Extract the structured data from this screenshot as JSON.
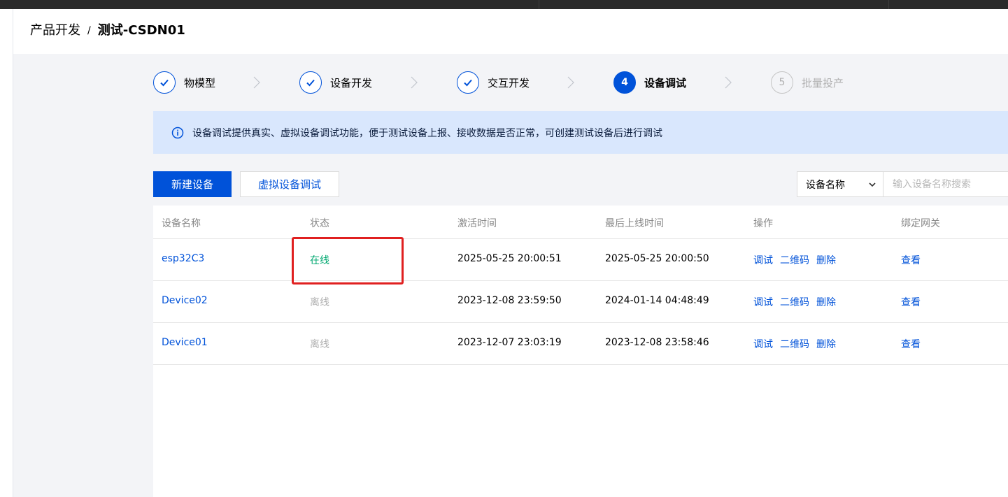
{
  "breadcrumb": {
    "parent": "产品开发",
    "separator": "/",
    "current": "测试-CSDN01"
  },
  "steps": [
    {
      "label": "物模型",
      "state": "done",
      "number": ""
    },
    {
      "label": "设备开发",
      "state": "done",
      "number": ""
    },
    {
      "label": "交互开发",
      "state": "done",
      "number": ""
    },
    {
      "label": "设备调试",
      "state": "active",
      "number": "4"
    },
    {
      "label": "批量投产",
      "state": "pending",
      "number": "5"
    }
  ],
  "notice": {
    "text": "设备调试提供真实、虚拟设备调试功能，便于测试设备上报、接收数据是否正常，可创建测试设备后进行调试"
  },
  "toolbar": {
    "new_device_label": "新建设备",
    "virtual_debug_label": "虚拟设备调试",
    "search_field_selected": "设备名称",
    "search_placeholder": "输入设备名称搜索"
  },
  "table": {
    "columns": [
      "设备名称",
      "状态",
      "激活时间",
      "最后上线时间",
      "操作",
      "绑定网关"
    ],
    "rows": [
      {
        "name": "esp32C3",
        "status": "在线",
        "online": true,
        "activated": "2025-05-25 20:00:51",
        "last_online": "2025-05-25 20:00:50"
      },
      {
        "name": "Device02",
        "status": "离线",
        "online": false,
        "activated": "2023-12-08 23:59:50",
        "last_online": "2024-01-14 04:48:49"
      },
      {
        "name": "Device01",
        "status": "离线",
        "online": false,
        "activated": "2023-12-07 23:03:19",
        "last_online": "2023-12-08 23:58:46"
      }
    ],
    "action_labels": {
      "debug": "调试",
      "qrcode": "二维码",
      "delete": "删除",
      "view": "查看"
    }
  },
  "colors": {
    "accent": "#0052d9",
    "online": "#00a870",
    "offline": "#b0b0b0",
    "notice_bg": "#d9e7fd",
    "highlight": "#e02020"
  }
}
